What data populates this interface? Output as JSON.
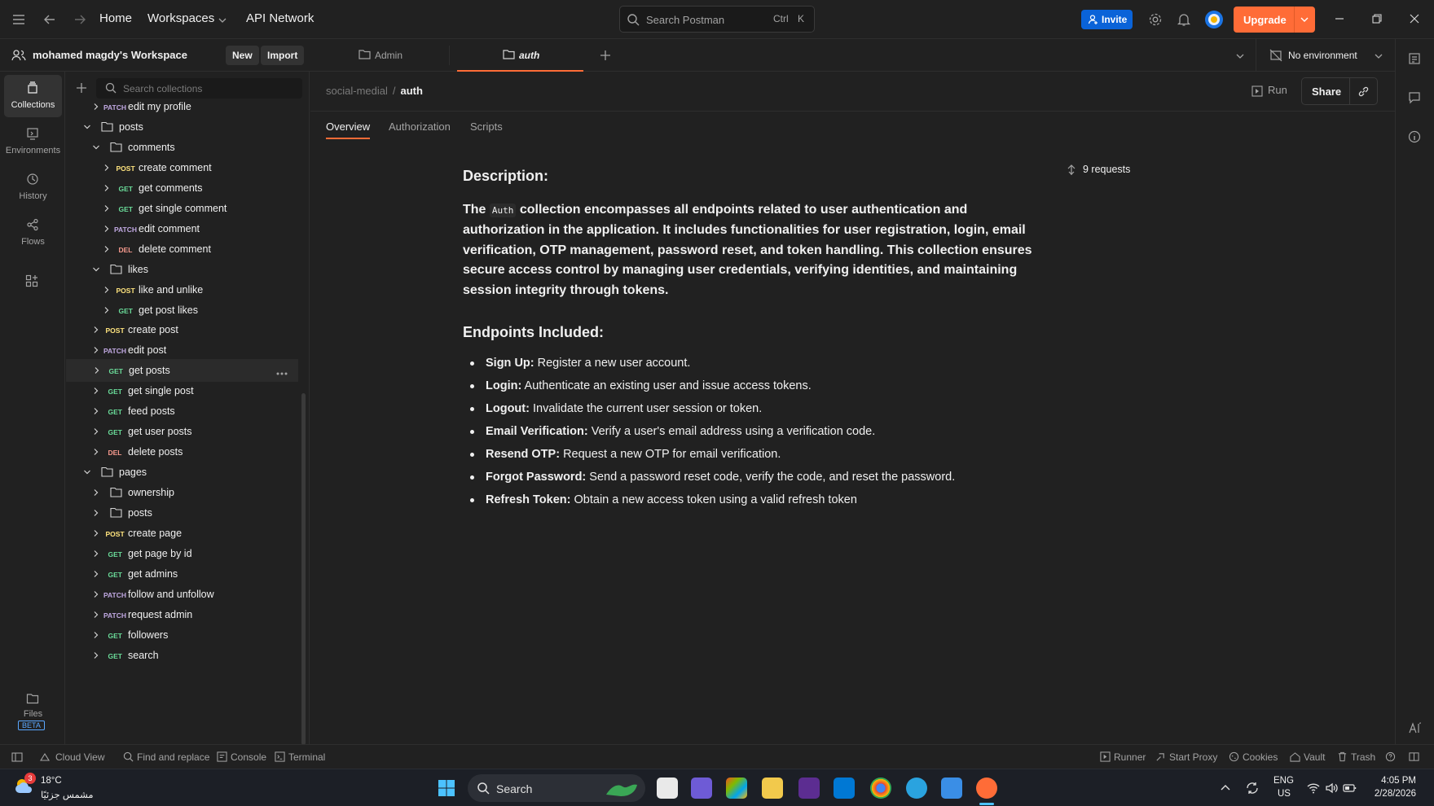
{
  "titlebar": {
    "home": "Home",
    "workspaces": "Workspaces",
    "api_network": "API Network",
    "search_placeholder": "Search Postman",
    "kbd_ctrl": "Ctrl",
    "kbd_k": "K",
    "invite": "Invite",
    "upgrade": "Upgrade"
  },
  "tabbar": {
    "workspace_name": "mohamed magdy's Workspace",
    "new": "New",
    "import": "Import",
    "tabs": [
      {
        "label": "Admin",
        "active": false
      },
      {
        "label": "auth",
        "active": true
      }
    ],
    "environment": "No environment"
  },
  "rail": [
    {
      "label": "Collections",
      "icon": "collections-icon",
      "active": true
    },
    {
      "label": "Environments",
      "icon": "environments-icon",
      "active": false
    },
    {
      "label": "History",
      "icon": "history-icon",
      "active": false
    },
    {
      "label": "Flows",
      "icon": "flows-icon",
      "active": false
    }
  ],
  "rail_bottom": {
    "files": "Files",
    "beta": "BETA"
  },
  "sidebar": {
    "search_placeholder": "Search collections",
    "tree": [
      {
        "type": "request",
        "method": "PATCH",
        "label": "edit my profile",
        "depth": 2
      },
      {
        "type": "folder",
        "label": "posts",
        "depth": 1,
        "open": true
      },
      {
        "type": "folder",
        "label": "comments",
        "depth": 2,
        "open": true
      },
      {
        "type": "request",
        "method": "POST",
        "label": "create comment",
        "depth": 3
      },
      {
        "type": "request",
        "method": "GET",
        "label": "get comments",
        "depth": 3
      },
      {
        "type": "request",
        "method": "GET",
        "label": "get single comment",
        "depth": 3
      },
      {
        "type": "request",
        "method": "PATCH",
        "label": "edit comment",
        "depth": 3
      },
      {
        "type": "request",
        "method": "DEL",
        "label": "delete comment",
        "depth": 3
      },
      {
        "type": "folder",
        "label": "likes",
        "depth": 2,
        "open": true
      },
      {
        "type": "request",
        "method": "POST",
        "label": "like and unlike",
        "depth": 3
      },
      {
        "type": "request",
        "method": "GET",
        "label": "get post likes",
        "depth": 3
      },
      {
        "type": "request",
        "method": "POST",
        "label": "create post",
        "depth": 2
      },
      {
        "type": "request",
        "method": "PATCH",
        "label": "edit post",
        "depth": 2
      },
      {
        "type": "request",
        "method": "GET",
        "label": "get posts",
        "depth": 2,
        "selected": true
      },
      {
        "type": "request",
        "method": "GET",
        "label": "get single post",
        "depth": 2
      },
      {
        "type": "request",
        "method": "GET",
        "label": "feed posts",
        "depth": 2
      },
      {
        "type": "request",
        "method": "GET",
        "label": "get user posts",
        "depth": 2
      },
      {
        "type": "request",
        "method": "DEL",
        "label": "delete posts",
        "depth": 2
      },
      {
        "type": "folder",
        "label": "pages",
        "depth": 1,
        "open": true
      },
      {
        "type": "folder",
        "label": "ownership",
        "depth": 2,
        "open": false
      },
      {
        "type": "folder",
        "label": "posts",
        "depth": 2,
        "open": false
      },
      {
        "type": "request",
        "method": "POST",
        "label": "create page",
        "depth": 2
      },
      {
        "type": "request",
        "method": "GET",
        "label": "get page by id",
        "depth": 2
      },
      {
        "type": "request",
        "method": "GET",
        "label": "get admins",
        "depth": 2
      },
      {
        "type": "request",
        "method": "PATCH",
        "label": "follow and unfollow",
        "depth": 2
      },
      {
        "type": "request",
        "method": "PATCH",
        "label": "request admin",
        "depth": 2
      },
      {
        "type": "request",
        "method": "GET",
        "label": "followers",
        "depth": 2
      },
      {
        "type": "request",
        "method": "GET",
        "label": "search",
        "depth": 2
      }
    ]
  },
  "main": {
    "breadcrumb_parent": "social-medial",
    "breadcrumb_sep": "/",
    "breadcrumb_current": "auth",
    "run": "Run",
    "share": "Share",
    "subtabs": [
      "Overview",
      "Authorization",
      "Scripts"
    ],
    "request_count": "9 requests",
    "description_heading": "Description:",
    "desc_pre": "The ",
    "desc_code": "Auth",
    "desc_post": " collection encompasses all endpoints related to user authentication and authorization in the application. It includes functionalities for user registration, login, email verification, OTP management, password reset, and token handling. This collection ensures secure access control by managing user credentials, verifying identities, and maintaining session integrity through tokens.",
    "endpoints_heading": "Endpoints Included:",
    "endpoints": [
      {
        "name": "Sign Up:",
        "text": " Register a new user account."
      },
      {
        "name": "Login:",
        "text": " Authenticate an existing user and issue access tokens."
      },
      {
        "name": "Logout:",
        "text": " Invalidate the current user session or token."
      },
      {
        "name": "Email Verification:",
        "text": " Verify a user's email address using a verification code."
      },
      {
        "name": "Resend OTP:",
        "text": " Request a new OTP for email verification."
      },
      {
        "name": "Forgot Password:",
        "text": " Send a password reset code, verify the code, and reset the password."
      },
      {
        "name": "Refresh Token:",
        "text": " Obtain a new access token using a valid refresh token"
      }
    ]
  },
  "statusbar": {
    "cloud_view": "Cloud View",
    "find_replace": "Find and replace",
    "console": "Console",
    "terminal": "Terminal",
    "runner": "Runner",
    "start_proxy": "Start Proxy",
    "cookies": "Cookies",
    "vault": "Vault",
    "trash": "Trash"
  },
  "taskbar": {
    "weather_badge": "3",
    "temp": "18°C",
    "weather_desc": "مشمس جزئيًا",
    "search": "Search",
    "lang_top": "ENG",
    "lang_bottom": "US",
    "time": "4:05 PM",
    "date": "2/28/2026"
  },
  "colors": {
    "accent": "#ff6c37",
    "invite": "#0a63d8",
    "get": "#6bdd9a",
    "post": "#ffe47e",
    "patch": "#c0a8e1",
    "del": "#f79a8e"
  }
}
